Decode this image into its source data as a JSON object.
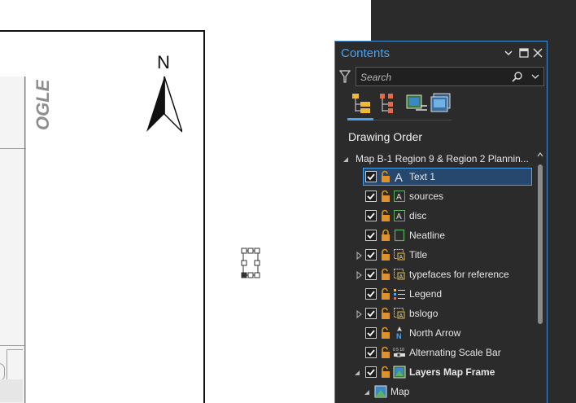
{
  "map": {
    "vertical_label": "OGLE",
    "north_arrow_letter": "N"
  },
  "contents_pane": {
    "title": "Contents",
    "search": {
      "placeholder": "Search"
    },
    "view_tabs": [
      {
        "icon": "list-by-drawing-order-icon",
        "selected": true
      },
      {
        "icon": "list-by-source-icon",
        "selected": false
      },
      {
        "icon": "list-by-selection-icon",
        "selected": false
      },
      {
        "icon": "list-by-editing-icon",
        "selected": false
      }
    ],
    "section_title": "Drawing Order",
    "tree": {
      "root": "Map B-1 Region 9 & Region 2 Plannin...",
      "items": [
        {
          "label": "Text 1",
          "icon": "text-element-icon",
          "checked": true,
          "locked": false,
          "selected": true,
          "expandable": false
        },
        {
          "label": "sources",
          "icon": "text-box-element-icon",
          "checked": true,
          "locked": false,
          "selected": false,
          "expandable": false
        },
        {
          "label": "disc",
          "icon": "text-box-element-icon",
          "checked": true,
          "locked": false,
          "selected": false,
          "expandable": false
        },
        {
          "label": "Neatline",
          "icon": "rectangle-element-icon",
          "checked": true,
          "locked": true,
          "selected": false,
          "expandable": false
        },
        {
          "label": "Title",
          "icon": "group-element-icon",
          "checked": true,
          "locked": false,
          "selected": false,
          "expandable": true
        },
        {
          "label": "typefaces for reference",
          "icon": "group-element-icon",
          "checked": true,
          "locked": false,
          "selected": false,
          "expandable": true
        },
        {
          "label": "Legend",
          "icon": "legend-element-icon",
          "checked": true,
          "locked": false,
          "selected": false,
          "expandable": false
        },
        {
          "label": "bslogo",
          "icon": "group-element-icon",
          "checked": true,
          "locked": false,
          "selected": false,
          "expandable": true
        },
        {
          "label": "North Arrow",
          "icon": "north-arrow-element-icon",
          "checked": true,
          "locked": false,
          "selected": false,
          "expandable": false
        },
        {
          "label": "Alternating Scale Bar",
          "icon": "scale-bar-element-icon",
          "checked": true,
          "locked": false,
          "selected": false,
          "expandable": false
        },
        {
          "label": "Layers Map Frame",
          "icon": "map-frame-icon",
          "checked": true,
          "locked": false,
          "selected": false,
          "expandable": true,
          "expanded": true,
          "bold": true
        },
        {
          "label": "Map",
          "icon": "map-icon",
          "checked": false,
          "locked": false,
          "selected": false,
          "expandable": true,
          "expanded": true,
          "bold": false
        }
      ]
    }
  },
  "colors": {
    "accent": "#4aa3f0",
    "pane_background": "#2b2b2b",
    "selection": "#26476e",
    "lock_unlocked": "#e0922a"
  }
}
